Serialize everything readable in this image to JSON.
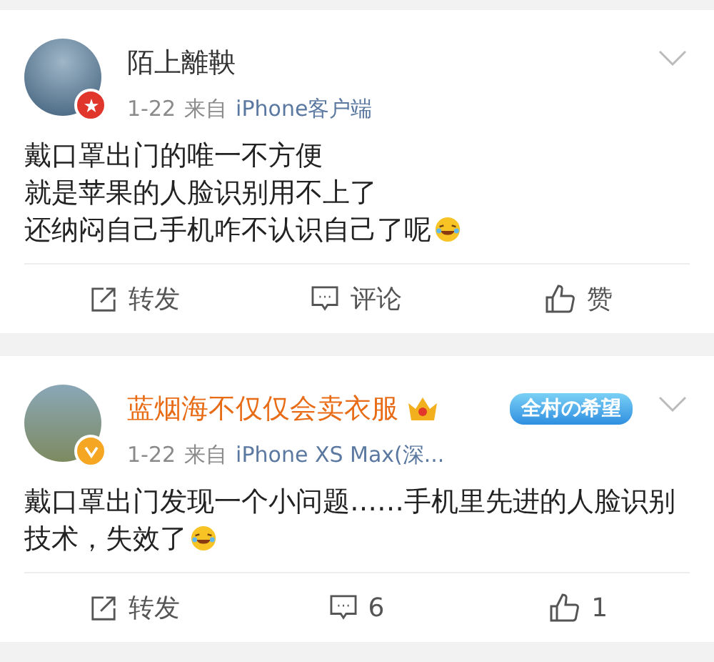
{
  "posts": [
    {
      "author": "陌上離鞅",
      "vip": false,
      "avatar": {
        "kind": "star"
      },
      "date": "1-22",
      "source_prefix": "来自",
      "source": "iPhone客户端",
      "body": [
        "戴口罩出门的唯一不方便",
        "就是苹果的人脸识别用不上了",
        "还纳闷自己手机咋不认识自己了呢"
      ],
      "actions": [
        {
          "kind": "repost",
          "label": "转发"
        },
        {
          "kind": "comment",
          "label": "评论"
        },
        {
          "kind": "like",
          "label": "赞"
        }
      ]
    },
    {
      "author": "蓝烟海不仅仅会卖衣服",
      "vip": true,
      "medal": "全村の希望",
      "avatar": {
        "kind": "verified"
      },
      "date": "1-22",
      "source_prefix": "来自",
      "source": "iPhone XS Max(深...",
      "body": [
        "戴口罩出门发现一个小问题……手机里先进的人脸识别技术，失效了"
      ],
      "actions": [
        {
          "kind": "repost",
          "label": "转发"
        },
        {
          "kind": "comment",
          "label": "6"
        },
        {
          "kind": "like",
          "label": "1"
        }
      ]
    }
  ]
}
